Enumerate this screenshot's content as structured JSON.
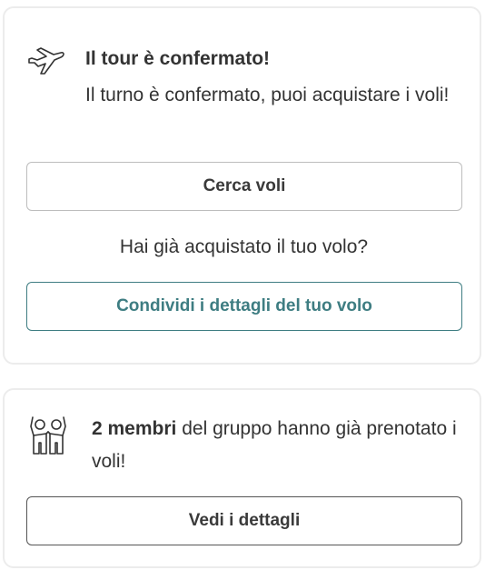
{
  "tour_card": {
    "icon": "airplane-icon",
    "title": "Il tour è confermato!",
    "message": "Il turno è confermato, puoi acquistare i voli!",
    "search_button": "Cerca voli",
    "question": "Hai già acquistato il tuo volo?",
    "share_button": "Condividi i dettagli del tuo volo",
    "accent_color": "#3e7d82"
  },
  "group_card": {
    "icon": "group-members-icon",
    "count_text": "2 membri",
    "message_rest": " del gruppo hanno già prenotato i voli!",
    "details_button": "Vedi i dettagli"
  }
}
